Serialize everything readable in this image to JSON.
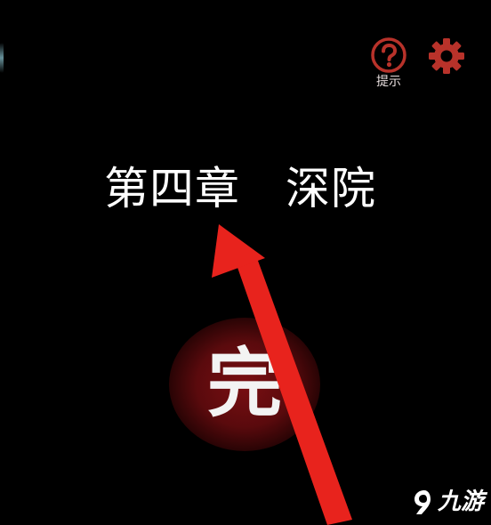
{
  "toolbar": {
    "hint_label": "提示",
    "hint_icon": "question-icon",
    "settings_icon": "gear-icon",
    "icon_color": "#b8322a"
  },
  "chapter": {
    "title": "第四章　深院"
  },
  "status": {
    "seal_text": "完",
    "seal_color": "#6a0c10"
  },
  "annotation": {
    "arrow_color": "#e8231d"
  },
  "watermark": {
    "text": "九游"
  }
}
